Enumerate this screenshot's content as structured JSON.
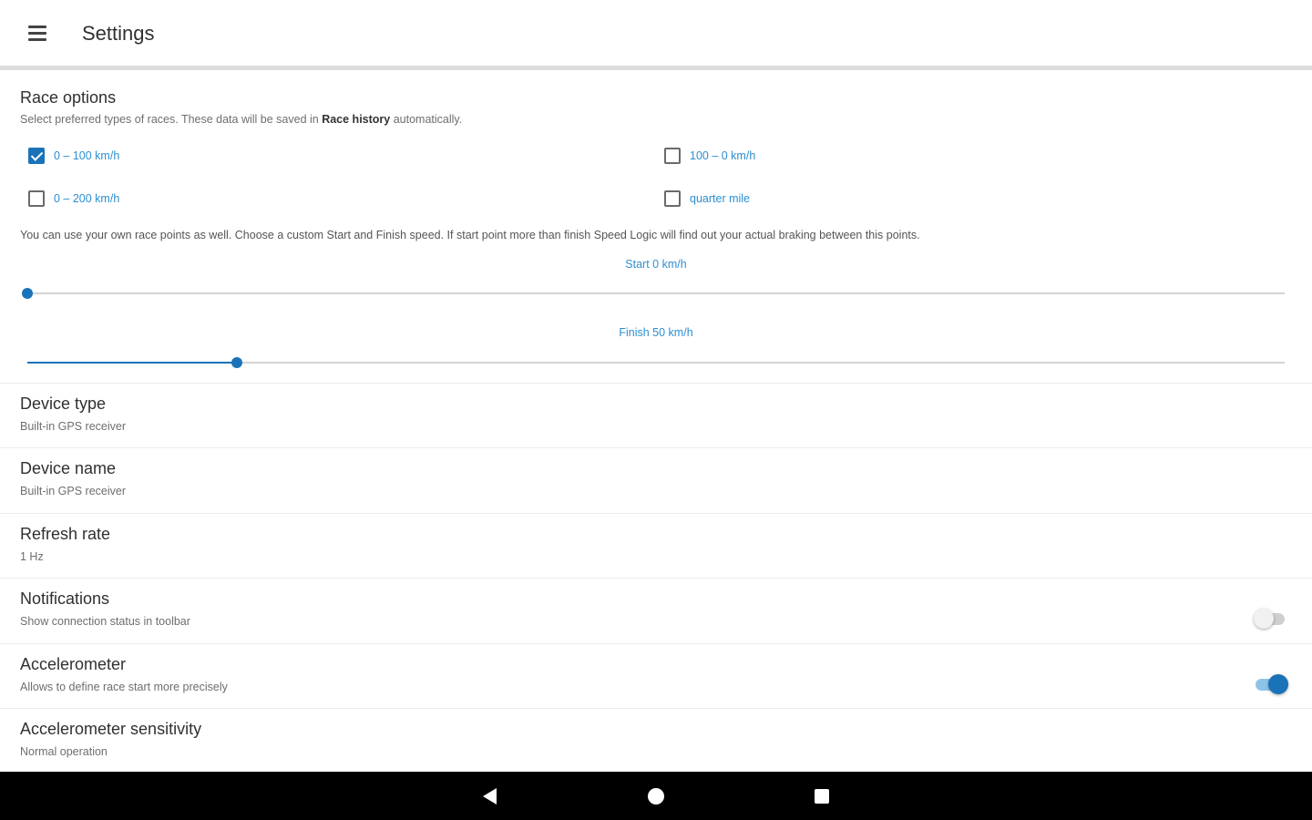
{
  "appbar": {
    "title": "Settings",
    "menu_icon": "hamburger-menu-icon"
  },
  "race_options": {
    "title": "Race options",
    "subtitle_prefix": "Select preferred types of races. These data will be saved in ",
    "subtitle_bold": "Race history",
    "subtitle_suffix": " automatically.",
    "checkboxes": [
      {
        "label": "0 – 100 km/h",
        "checked": true
      },
      {
        "label": "100 – 0 km/h",
        "checked": false
      },
      {
        "label": "0 – 200 km/h",
        "checked": false
      },
      {
        "label": "quarter mile",
        "checked": false
      }
    ],
    "custom_info": "You can use your own race points as well. Choose a custom Start and Finish speed. If start point more than finish Speed Logic will find out your actual braking between this points.",
    "start_slider": {
      "label": "Start 0 km/h",
      "value_fraction": 0.0
    },
    "finish_slider": {
      "label": "Finish 50 km/h",
      "value_fraction": 0.167
    }
  },
  "preferences": [
    {
      "title": "Device type",
      "subtitle": "Built-in GPS receiver"
    },
    {
      "title": "Device name",
      "subtitle": "Built-in GPS receiver"
    },
    {
      "title": "Refresh rate",
      "subtitle": "1 Hz"
    },
    {
      "title": "Notifications",
      "subtitle": "Show connection status in toolbar",
      "switch_on": false
    },
    {
      "title": "Accelerometer",
      "subtitle": "Allows to define race start more precisely",
      "switch_on": true
    },
    {
      "title": "Accelerometer sensitivity",
      "subtitle": "Normal operation"
    }
  ],
  "navbar": {
    "back_icon": "back-triangle-icon",
    "home_icon": "home-circle-icon",
    "recents_icon": "recents-square-icon"
  },
  "colors": {
    "accent": "#1a73b8",
    "link_text": "#2d8fd1",
    "navbar_bg": "#000000"
  }
}
